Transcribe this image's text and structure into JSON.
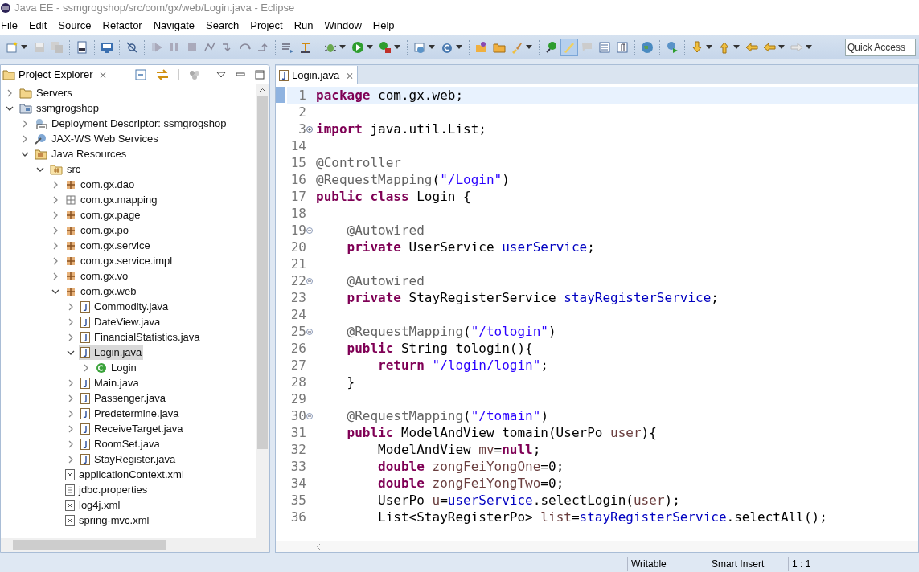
{
  "window": {
    "title": "Java EE - ssmgrogshop/src/com/gx/web/Login.java - Eclipse"
  },
  "menu": [
    "File",
    "Edit",
    "Source",
    "Refactor",
    "Navigate",
    "Search",
    "Project",
    "Run",
    "Window",
    "Help"
  ],
  "quick_access": {
    "placeholder": "Quick Access"
  },
  "project_explorer": {
    "title": "Project Explorer",
    "close": "⨯",
    "tree": [
      {
        "label": "Servers",
        "kind": "folder",
        "expanded": false,
        "selected": false
      },
      {
        "label": "ssmgrogshop",
        "kind": "project",
        "expanded": true,
        "selected": false,
        "children": [
          {
            "label": "Deployment Descriptor: ssmgrogshop",
            "kind": "descriptor",
            "expanded": false,
            "selected": false
          },
          {
            "label": "JAX-WS Web Services",
            "kind": "webservices",
            "expanded": false,
            "selected": false
          },
          {
            "label": "Java Resources",
            "kind": "resources",
            "expanded": true,
            "selected": false,
            "children": [
              {
                "label": "src",
                "kind": "source",
                "expanded": true,
                "selected": false,
                "children": [
                  {
                    "label": "com.gx.dao",
                    "kind": "package",
                    "expanded": false,
                    "selected": false
                  },
                  {
                    "label": "com.gx.mapping",
                    "kind": "mapping",
                    "expanded": false,
                    "selected": false
                  },
                  {
                    "label": "com.gx.page",
                    "kind": "package",
                    "expanded": false,
                    "selected": false
                  },
                  {
                    "label": "com.gx.po",
                    "kind": "package",
                    "expanded": false,
                    "selected": false
                  },
                  {
                    "label": "com.gx.service",
                    "kind": "package",
                    "expanded": false,
                    "selected": false
                  },
                  {
                    "label": "com.gx.service.impl",
                    "kind": "package",
                    "expanded": false,
                    "selected": false
                  },
                  {
                    "label": "com.gx.vo",
                    "kind": "package",
                    "expanded": false,
                    "selected": false
                  },
                  {
                    "label": "com.gx.web",
                    "kind": "package",
                    "expanded": true,
                    "selected": false,
                    "children": [
                      {
                        "label": "Commodity.java",
                        "kind": "java",
                        "expanded": false,
                        "selected": false
                      },
                      {
                        "label": "DateView.java",
                        "kind": "java",
                        "expanded": false,
                        "selected": false
                      },
                      {
                        "label": "FinancialStatistics.java",
                        "kind": "java",
                        "expanded": false,
                        "selected": false
                      },
                      {
                        "label": "Login.java",
                        "kind": "java",
                        "expanded": true,
                        "selected": true,
                        "children": [
                          {
                            "label": "Login",
                            "kind": "class",
                            "expanded": false,
                            "selected": false
                          }
                        ]
                      },
                      {
                        "label": "Main.java",
                        "kind": "java",
                        "expanded": false,
                        "selected": false
                      },
                      {
                        "label": "Passenger.java",
                        "kind": "java",
                        "expanded": false,
                        "selected": false
                      },
                      {
                        "label": "Predetermine.java",
                        "kind": "java",
                        "expanded": false,
                        "selected": false
                      },
                      {
                        "label": "ReceiveTarget.java",
                        "kind": "java",
                        "expanded": false,
                        "selected": false
                      },
                      {
                        "label": "RoomSet.java",
                        "kind": "java",
                        "expanded": false,
                        "selected": false
                      },
                      {
                        "label": "StayRegister.java",
                        "kind": "java",
                        "expanded": false,
                        "selected": false
                      }
                    ]
                  },
                  {
                    "label": "applicationContext.xml",
                    "kind": "xml",
                    "selected": false
                  },
                  {
                    "label": "jdbc.properties",
                    "kind": "properties",
                    "selected": false
                  },
                  {
                    "label": "log4j.xml",
                    "kind": "xml",
                    "selected": false
                  },
                  {
                    "label": "spring-mvc.xml",
                    "kind": "xml",
                    "selected": false
                  }
                ]
              }
            ]
          }
        ]
      }
    ]
  },
  "editor": {
    "tab": {
      "label": "Login.java",
      "close": "⨯",
      "selected": true
    },
    "lines": [
      {
        "number": "1",
        "current": true,
        "tokens": [
          {
            "kind": "keyword",
            "text": "package"
          },
          {
            "kind": "plain",
            "text": " com.gx.web;"
          }
        ]
      },
      {
        "number": "2",
        "current": false
      },
      {
        "number": "3",
        "current": false,
        "fold_collapsed": true,
        "tokens": [
          {
            "kind": "keyword",
            "text": "import"
          },
          {
            "kind": "plain",
            "text": " java.util.List;"
          }
        ]
      },
      {
        "number": "14",
        "current": false
      },
      {
        "number": "15",
        "current": false,
        "tokens": [
          {
            "kind": "annotation",
            "text": "@Controller"
          }
        ]
      },
      {
        "number": "16",
        "current": false,
        "tokens": [
          {
            "kind": "annotation",
            "text": "@RequestMapping"
          },
          {
            "kind": "plain",
            "text": "("
          },
          {
            "kind": "string",
            "text": "\"/Login\""
          },
          {
            "kind": "plain",
            "text": ")"
          }
        ]
      },
      {
        "number": "17",
        "current": false,
        "tokens": [
          {
            "kind": "keyword",
            "text": "public class"
          },
          {
            "kind": "plain",
            "text": " Login {"
          }
        ]
      },
      {
        "number": "18",
        "current": false
      },
      {
        "number": "19",
        "current": false,
        "fold_collapsed": false,
        "tokens": [
          {
            "kind": "annotation",
            "text": "    @Autowired"
          }
        ]
      },
      {
        "number": "20",
        "current": false,
        "tokens": [
          {
            "kind": "keyword",
            "text": "    private"
          },
          {
            "kind": "plain",
            "text": " UserService "
          },
          {
            "kind": "field",
            "text": "userService"
          },
          {
            "kind": "plain",
            "text": ";"
          }
        ]
      },
      {
        "number": "21",
        "current": false
      },
      {
        "number": "22",
        "current": false,
        "fold_collapsed": false,
        "tokens": [
          {
            "kind": "annotation",
            "text": "    @Autowired"
          }
        ]
      },
      {
        "number": "23",
        "current": false,
        "tokens": [
          {
            "kind": "keyword",
            "text": "    private"
          },
          {
            "kind": "plain",
            "text": " StayRegisterService "
          },
          {
            "kind": "field",
            "text": "stayRegisterService"
          },
          {
            "kind": "plain",
            "text": ";"
          }
        ]
      },
      {
        "number": "24",
        "current": false
      },
      {
        "number": "25",
        "current": false,
        "fold_collapsed": false,
        "tokens": [
          {
            "kind": "annotation",
            "text": "    @RequestMapping"
          },
          {
            "kind": "plain",
            "text": "("
          },
          {
            "kind": "string",
            "text": "\"/tologin\""
          },
          {
            "kind": "plain",
            "text": ")"
          }
        ]
      },
      {
        "number": "26",
        "current": false,
        "tokens": [
          {
            "kind": "keyword",
            "text": "    public"
          },
          {
            "kind": "plain",
            "text": " String tologin(){"
          }
        ]
      },
      {
        "number": "27",
        "current": false,
        "tokens": [
          {
            "kind": "keyword",
            "text": "        return"
          },
          {
            "kind": "string",
            "text": " \"/login/login\""
          },
          {
            "kind": "plain",
            "text": ";"
          }
        ]
      },
      {
        "number": "28",
        "current": false,
        "tokens": [
          {
            "kind": "plain",
            "text": "    }"
          }
        ]
      },
      {
        "number": "29",
        "current": false
      },
      {
        "number": "30",
        "current": false,
        "fold_collapsed": false,
        "tokens": [
          {
            "kind": "annotation",
            "text": "    @RequestMapping"
          },
          {
            "kind": "plain",
            "text": "("
          },
          {
            "kind": "string",
            "text": "\"/tomain\""
          },
          {
            "kind": "plain",
            "text": ")"
          }
        ]
      },
      {
        "number": "31",
        "current": false,
        "tokens": [
          {
            "kind": "keyword",
            "text": "    public"
          },
          {
            "kind": "plain",
            "text": " ModelAndView tomain(UserPo "
          },
          {
            "kind": "local",
            "text": "user"
          },
          {
            "kind": "plain",
            "text": "){"
          }
        ]
      },
      {
        "number": "32",
        "current": false,
        "tokens": [
          {
            "kind": "plain",
            "text": "        ModelAndView "
          },
          {
            "kind": "local",
            "text": "mv"
          },
          {
            "kind": "plain",
            "text": "="
          },
          {
            "kind": "keyword",
            "text": "null"
          },
          {
            "kind": "plain",
            "text": ";"
          }
        ]
      },
      {
        "number": "33",
        "current": false,
        "tokens": [
          {
            "kind": "keyword",
            "text": "        double"
          },
          {
            "kind": "local",
            "text": " zongFeiYongOne"
          },
          {
            "kind": "plain",
            "text": "=0;"
          }
        ]
      },
      {
        "number": "34",
        "current": false,
        "tokens": [
          {
            "kind": "keyword",
            "text": "        double"
          },
          {
            "kind": "local",
            "text": " zongFeiYongTwo"
          },
          {
            "kind": "plain",
            "text": "=0;"
          }
        ]
      },
      {
        "number": "35",
        "current": false,
        "tokens": [
          {
            "kind": "plain",
            "text": "        UserPo "
          },
          {
            "kind": "local",
            "text": "u"
          },
          {
            "kind": "plain",
            "text": "="
          },
          {
            "kind": "field",
            "text": "userService"
          },
          {
            "kind": "plain",
            "text": ".selectLogin("
          },
          {
            "kind": "local",
            "text": "user"
          },
          {
            "kind": "plain",
            "text": ");"
          }
        ]
      },
      {
        "number": "36",
        "current": false,
        "tokens": [
          {
            "kind": "plain",
            "text": "        List<StayRegisterPo> "
          },
          {
            "kind": "local",
            "text": "list"
          },
          {
            "kind": "plain",
            "text": "="
          },
          {
            "kind": "field",
            "text": "stayRegisterService"
          },
          {
            "kind": "plain",
            "text": ".selectAll();"
          }
        ]
      }
    ]
  },
  "status_bar": [
    "Writable",
    "Smart Insert",
    "1 : 1"
  ]
}
